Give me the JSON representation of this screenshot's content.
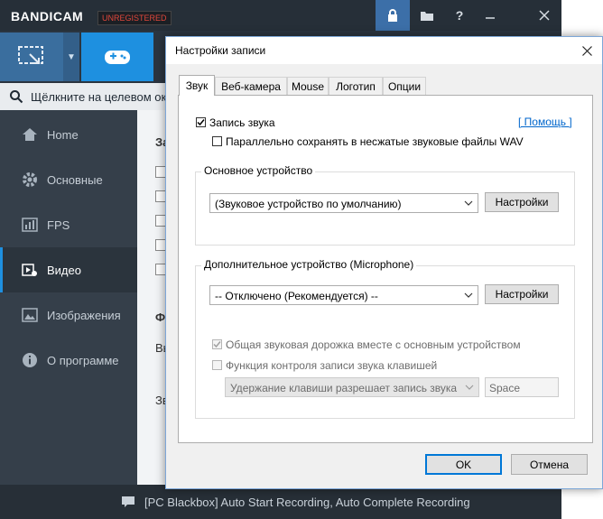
{
  "app": {
    "logo": "BANDICAM",
    "badge": "UNREGISTERED"
  },
  "title_buttons": [
    "lock-icon",
    "folder-icon",
    "help-icon",
    "minimize-icon",
    "close-icon"
  ],
  "search": {
    "text": "Щёлкните на целевом окн"
  },
  "sidebar": {
    "items": [
      {
        "label": "Home",
        "icon": "home-icon"
      },
      {
        "label": "Основные",
        "icon": "gear-icon"
      },
      {
        "label": "FPS",
        "icon": "fps-icon"
      },
      {
        "label": "Видео",
        "icon": "video-icon"
      },
      {
        "label": "Изображения",
        "icon": "image-icon"
      },
      {
        "label": "О программе",
        "icon": "info-icon"
      }
    ]
  },
  "content_fragments": {
    "a": "За",
    "b": "Ф",
    "c": "Вь",
    "d": "Зв"
  },
  "status": {
    "text": "[PC Blackbox] Auto Start Recording, Auto Complete Recording"
  },
  "dialog": {
    "title": "Настройки записи",
    "tabs": [
      "Звук",
      "Веб-камера",
      "Mouse",
      "Логотип",
      "Опции"
    ],
    "record_sound": "Запись звука",
    "help_link": "[ Помощь ]",
    "save_wav": "Параллельно сохранять в несжатые звуковые файлы WAV",
    "primary_group": "Основное устройство",
    "primary_device": "(Звуковое устройство по умолчанию)",
    "settings_btn": "Настройки",
    "secondary_group": "Дополнительное устройство (Microphone)",
    "secondary_device": "-- Отключено (Рекомендуется) --",
    "common_track": "Общая звуковая дорожка вместе с основным устройством",
    "key_control": "Функция контроля записи звука клавишей",
    "key_mode": "Удержание клавиши разрешает запись звука",
    "hotkey": "Space",
    "ok": "OK",
    "cancel": "Отмена"
  }
}
